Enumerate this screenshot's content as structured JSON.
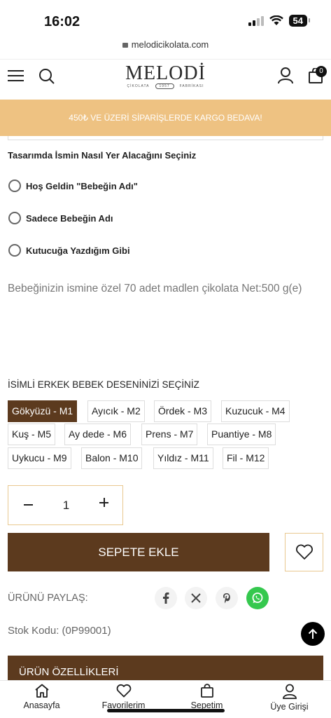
{
  "status": {
    "time": "16:02",
    "battery": "54"
  },
  "browser": {
    "url": "melodicikolata.com"
  },
  "header": {
    "logo_main": "MELODİ",
    "logo_left": "ÇİKOLATA",
    "logo_year": "1957",
    "logo_right": "FABRİKASI",
    "cart_count": "0"
  },
  "promo": {
    "text": "450₺ VE ÜZERİ SİPARİŞLERDE KARGO BEDAVA!"
  },
  "name_placement": {
    "title": "Tasarımda İsmin Nasıl Yer Alacağını Seçiniz",
    "options": [
      {
        "label": "Hoş Geldin \"Bebeğin Adı\""
      },
      {
        "label": "Sadece Bebeğin Adı"
      },
      {
        "label": "Kutucuğa Yazdığım Gibi"
      }
    ]
  },
  "description": "Bebeğinizin ismine özel 70 adet madlen çikolata Net:500 g(e)",
  "patterns": {
    "title": "İSİMLİ ERKEK BEBEK DESENİNİZİ SEÇİNİZ",
    "selected": "Gökyüzü - M1",
    "options": [
      "Gökyüzü - M1",
      "Ayıcık - M2",
      "Ördek - M3",
      "Kuzucuk - M4",
      "Kuş - M5",
      "Ay dede - M6",
      "Prens - M7",
      "Puantiye - M8",
      "Uykucu - M9",
      "Balon - M10",
      "Yıldız - M11",
      "Fil - M12"
    ]
  },
  "quantity": {
    "value": "1"
  },
  "actions": {
    "add_to_cart": "SEPETE EKLE"
  },
  "share": {
    "label": "ÜRÜNÜ PAYLAŞ:",
    "networks": [
      "facebook",
      "x",
      "pinterest",
      "whatsapp"
    ]
  },
  "stock": {
    "text": "Stok Kodu: (0P99001)"
  },
  "features": {
    "title": "ÜRÜN ÖZELLİKLERİ"
  },
  "bottom_nav": [
    {
      "label": "Anasayfa"
    },
    {
      "label": "Favorilerim"
    },
    {
      "label": "Sepetim"
    },
    {
      "label": "Üye Girişi"
    }
  ],
  "colors": {
    "brand_brown": "#5c3a1e",
    "promo_gold": "#eec282",
    "whatsapp": "#35c84e"
  }
}
